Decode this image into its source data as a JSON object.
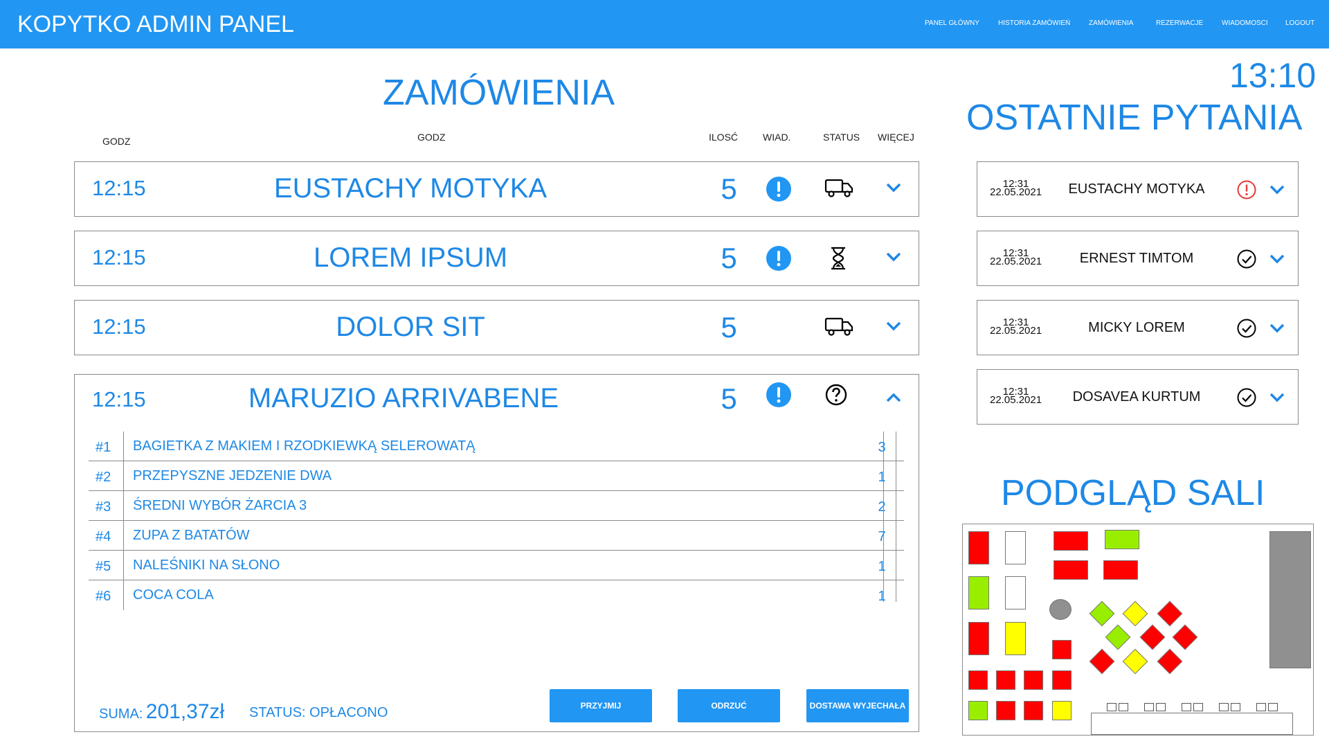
{
  "header": {
    "brand": "KOPYTKO ADMIN PANEL",
    "nav": [
      "PANEL GŁÓWNY",
      "HISTORIA ZAMÓWIEŃ",
      "ZAMÓWIENIA",
      "REZERWACJE",
      "WIADOMOSCI",
      "LOGOUT"
    ]
  },
  "clock": "13:10",
  "orders": {
    "title": "ZAMÓWIENIA",
    "columns": [
      "GODZ",
      "GODZ",
      "ILOSĆ",
      "WIAD.",
      "STATUS",
      "WIĘCEJ"
    ],
    "rows": [
      {
        "time": "12:15",
        "name": "EUSTACHY MOTYKA",
        "qty": "5",
        "message": true,
        "status": "truck-icon",
        "expanded": false
      },
      {
        "time": "12:15",
        "name": "LOREM IPSUM",
        "qty": "5",
        "message": true,
        "status": "hourglass-icon",
        "expanded": false
      },
      {
        "time": "12:15",
        "name": "DOLOR SIT",
        "qty": "5",
        "message": false,
        "status": "truck-icon",
        "expanded": false
      },
      {
        "time": "12:15",
        "name": "MARUZIO ARRIVABENE",
        "qty": "5",
        "message": true,
        "status": "question-icon",
        "expanded": true
      }
    ],
    "expanded_items": [
      {
        "num": "#1",
        "name": "BAGIETKA Z MAKIEM I RZODKIEWKĄ SELEROWATĄ",
        "qty": "3"
      },
      {
        "num": "#2",
        "name": "PRZEPYSZNE JEDZENIE DWA",
        "qty": "1"
      },
      {
        "num": "#3",
        "name": "ŚREDNI WYBÓR ŻARCIA 3",
        "qty": "2"
      },
      {
        "num": "#4",
        "name": "ZUPA Z BATATÓW",
        "qty": "7"
      },
      {
        "num": "#5",
        "name": "NALEŚNIKI NA SŁONO",
        "qty": "1"
      },
      {
        "num": "#6",
        "name": "COCA COLA",
        "qty": "1"
      }
    ],
    "sum_label": "SUMA:",
    "sum_value": "201,37zł",
    "status_text": "STATUS: OPŁACONO",
    "buttons": {
      "accept": "PRZYJMIJ",
      "reject": "ODRZUĆ",
      "delivery": "DOSTAWA WYJECHAŁA"
    }
  },
  "questions": {
    "title": "OSTATNIE PYTANIA",
    "items": [
      {
        "time": "12:31",
        "date": "22.05.2021",
        "name": "EUSTACHY MOTYKA",
        "state": "alert-circle-icon"
      },
      {
        "time": "12:31",
        "date": "22.05.2021",
        "name": "ERNEST TIMTOM",
        "state": "check-circle-icon"
      },
      {
        "time": "12:31",
        "date": "22.05.2021",
        "name": "MICKY LOREM",
        "state": "check-circle-icon"
      },
      {
        "time": "12:31",
        "date": "22.05.2021",
        "name": "DOSAVEA KURTUM",
        "state": "check-circle-icon"
      }
    ]
  },
  "room": {
    "title": "PODGLĄD SALI",
    "colors": {
      "occupied": "#ff0000",
      "free": "#99ee00",
      "reserved": "#ffff00",
      "inactive": "#ffffff",
      "bar": "#909090"
    }
  },
  "colors": {
    "accent": "#2196F3",
    "text_blue": "#1E88E5"
  }
}
